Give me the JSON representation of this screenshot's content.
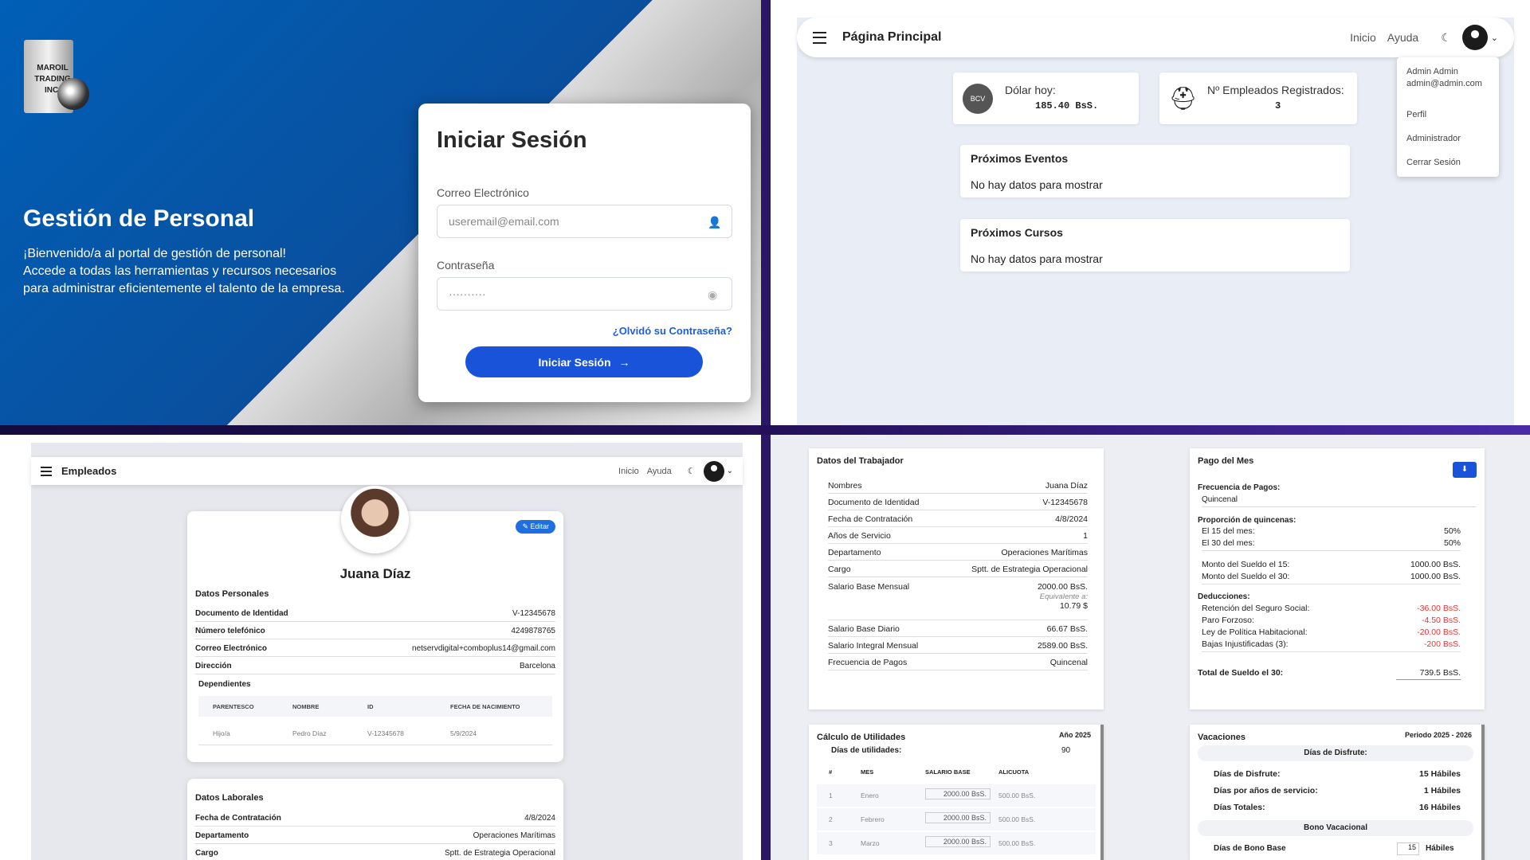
{
  "login": {
    "logo_lines": [
      "MAROIL",
      "TRADING",
      "INC."
    ],
    "hero_title": "Gestión de Personal",
    "hero_lines": [
      "¡Bienvenido/a al portal de gestión de personal!",
      "Accede a todas las herramientas y recursos necesarios",
      "para administrar eficientemente el talento de la empresa."
    ],
    "title": "Iniciar Sesión",
    "email_label": "Correo Electrónico",
    "email_placeholder": "useremail@email.com",
    "password_label": "Contraseña",
    "password_value": "··········",
    "forgot": "¿Olvidó su Contraseña?",
    "button": "Iniciar Sesión"
  },
  "home": {
    "title": "Página Principal",
    "nav": [
      "Inicio",
      "Ayuda"
    ],
    "dolar_label": "Dólar hoy:",
    "dolar_value": "185.40 BsS.",
    "emp_label": "Nº Empleados Registrados:",
    "emp_value": "3",
    "events_title": "Próximos Eventos",
    "events_empty": "No hay datos para mostrar",
    "courses_title": "Próximos Cursos",
    "courses_empty": "No hay datos para mostrar",
    "menu": {
      "name": "Admin Admin",
      "email": "admin@admin.com",
      "items": [
        "Perfil",
        "Administrador",
        "Cerrar Sesión"
      ]
    },
    "bcv": "BCV"
  },
  "employee": {
    "title": "Empleados",
    "nav": [
      "Inicio",
      "Ayuda"
    ],
    "edit": "Editar",
    "name": "Juana Díaz",
    "personal_title": "Datos Personales",
    "personal": [
      [
        "Documento de Identidad",
        "V-12345678"
      ],
      [
        "Número telefónico",
        "4249878765"
      ],
      [
        "Correo Electrónico",
        "netservdigital+comboplus14@gmail.com"
      ],
      [
        "Dirección",
        "Barcelona"
      ]
    ],
    "dependents_label": "Dependientes",
    "dep_headers": [
      "PARENTESCO",
      "NOMBRE",
      "ID",
      "FECHA DE NACIMIENTO"
    ],
    "dep_row": [
      "Hijo/a",
      "Pedro Díaz",
      "V-12345678",
      "5/9/2024"
    ],
    "work_title": "Datos Laborales",
    "work": [
      [
        "Fecha de Contratación",
        "4/8/2024"
      ],
      [
        "Departamento",
        "Operaciones Marítimas"
      ],
      [
        "Cargo",
        "Sptt. de Estrategia Operacional"
      ]
    ]
  },
  "worker": {
    "title": "Datos del Trabajador",
    "rows": [
      [
        "Nombres",
        "Juana Díaz"
      ],
      [
        "Documento de Identidad",
        "V-12345678"
      ],
      [
        "Fecha de Contratación",
        "4/8/2024"
      ],
      [
        "Años de Servicio",
        "1"
      ],
      [
        "Departamento",
        "Operaciones Marítimas"
      ],
      [
        "Cargo",
        "Sptt. de Estrategia Operacional"
      ]
    ],
    "salary_label": "Salario Base Mensual",
    "salary_value": "2000.00  BsS.",
    "equiv_label": "Equivalente a:",
    "equiv_value": "10.79  $",
    "rows2": [
      [
        "Salario Base Diario",
        "66.67  BsS."
      ],
      [
        "Salario Integral Mensual",
        "2589.00  BsS."
      ],
      [
        "Frecuencia de Pagos",
        "Quincenal"
      ]
    ]
  },
  "pay": {
    "title": "Pago del Mes",
    "freq_label": "Frecuencia de Pagos:",
    "freq_value": "Quincenal",
    "prop_label": "Proporción de quincenas:",
    "prop": [
      [
        "El 15 del mes:",
        "50%"
      ],
      [
        "El 30 del mes:",
        "50%"
      ]
    ],
    "monto": [
      [
        "Monto del Sueldo el 15:",
        "1000.00  BsS."
      ],
      [
        "Monto del Sueldo el 30:",
        "1000.00  BsS."
      ]
    ],
    "ded_label": "Deducciones:",
    "ded": [
      [
        "Retención del Seguro Social:",
        "-36.00  BsS."
      ],
      [
        "Paro Forzoso:",
        "-4.50  BsS."
      ],
      [
        "Ley de Política Habitacional:",
        "-20.00  BsS."
      ],
      [
        "Bajas Injustificadas (3):",
        "-200  BsS."
      ]
    ],
    "total_label": "Total de Sueldo el 30:",
    "total_value": "739.5  BsS."
  },
  "util": {
    "title": "Cálculo de Utilidades",
    "year": "Año 2025",
    "days_label": "Días de utilidades:",
    "days_value": "90",
    "headers": [
      "#",
      "MES",
      "SALARIO BASE",
      "ALICUOTA"
    ],
    "rows": [
      [
        "1",
        "Enero",
        "2000.00",
        "500.00  BsS."
      ],
      [
        "2",
        "Febrero",
        "2000.00",
        "500.00  BsS."
      ],
      [
        "3",
        "Marzo",
        "2000.00",
        "500.00  BsS."
      ]
    ],
    "unit": "BsS."
  },
  "vac": {
    "title": "Vacaciones",
    "period": "Periodo 2025 - 2026",
    "sub1": "Días de Disfrute:",
    "rows": [
      [
        "Días de Disfrute:",
        "15 Hábiles"
      ],
      [
        "Días por años de servicio:",
        "1 Hábiles"
      ],
      [
        "Días Totales:",
        "16 Hábiles"
      ]
    ],
    "sub2": "Bono Vacacional",
    "bono_label": "Días de Bono Base",
    "bono_value": "15",
    "bono_unit": "Hábiles"
  },
  "colors": {
    "primary": "#1953d9",
    "brand_blue": "#005fb6",
    "danger": "#e33"
  }
}
